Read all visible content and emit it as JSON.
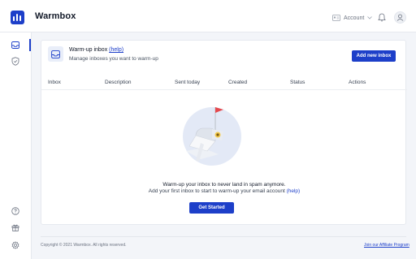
{
  "app": {
    "title": "Warmbox"
  },
  "header": {
    "account_label": "Account",
    "icons": [
      "id-card-icon",
      "chevron-down-icon",
      "bell-icon",
      "user-icon"
    ]
  },
  "sidebar": {
    "items": [
      {
        "icon": "inbox-icon",
        "active": true
      },
      {
        "icon": "shield-icon",
        "active": false
      }
    ],
    "bottom_items": [
      {
        "icon": "help-icon"
      },
      {
        "icon": "gift-icon"
      },
      {
        "icon": "gear-icon"
      }
    ]
  },
  "page": {
    "title": "Warm-up inbox",
    "help_link": "(help)",
    "subtitle": "Manage inboxes you want to warm-up",
    "add_button": "Add new inbox"
  },
  "table": {
    "columns": [
      "Inbox",
      "Description",
      "Sent today",
      "Created",
      "Status",
      "Actions"
    ]
  },
  "empty_state": {
    "title": "Warm-up your inbox to never land in spam anymore.",
    "subtitle": "Add your first inbox to start to warm-up your email account",
    "help_link": "(help)",
    "button": "Get Started"
  },
  "footer": {
    "copyright": "Copyright © 2021 Warmbox. All rights reserved.",
    "affiliate_link": "Join our Affiliate Program"
  },
  "colors": {
    "brand": "#1d3fc9",
    "background": "#f3f5f9",
    "flag": "#e5484d",
    "mailbox": "#dfe4ec"
  }
}
